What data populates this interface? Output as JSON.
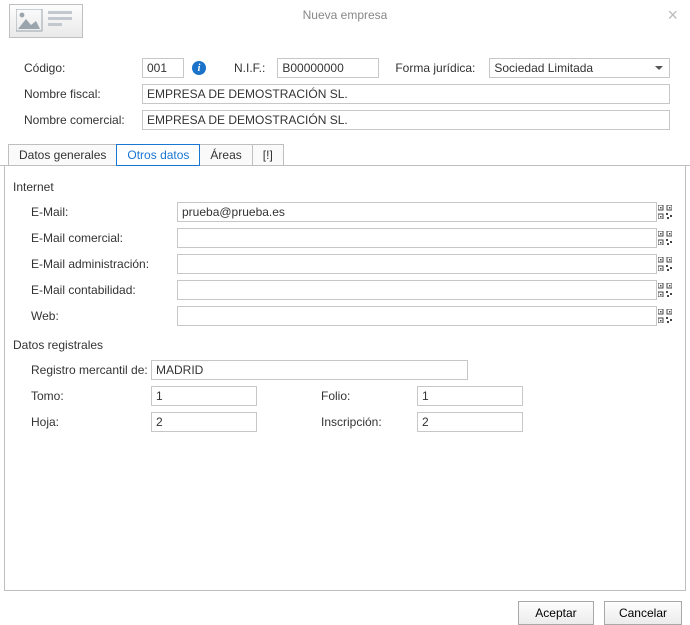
{
  "window": {
    "title": "Nueva empresa"
  },
  "header": {
    "codigo_label": "Código:",
    "codigo_value": "001",
    "nif_label": "N.I.F.:",
    "nif_value": "B00000000",
    "forma_label": "Forma jurídica:",
    "forma_value": "Sociedad Limitada",
    "nombre_fiscal_label": "Nombre fiscal:",
    "nombre_fiscal_value": "EMPRESA DE DEMOSTRACIÓN SL.",
    "nombre_comercial_label": "Nombre comercial:",
    "nombre_comercial_value": "EMPRESA DE DEMOSTRACIÓN SL."
  },
  "tabs": {
    "generales": "Datos generales",
    "otros": "Otros datos",
    "areas": "Áreas",
    "alert": "[!]"
  },
  "internet": {
    "section_title": "Internet",
    "email_label": "E-Mail:",
    "email_value": "prueba@prueba.es",
    "email_comercial_label": "E-Mail comercial:",
    "email_comercial_value": "",
    "email_admin_label": "E-Mail administración:",
    "email_admin_value": "",
    "email_cont_label": "E-Mail contabilidad:",
    "email_cont_value": "",
    "web_label": "Web:",
    "web_value": ""
  },
  "registrales": {
    "section_title": "Datos registrales",
    "registro_label": "Registro mercantil de:",
    "registro_value": "MADRID",
    "tomo_label": "Tomo:",
    "tomo_value": "1",
    "folio_label": "Folio:",
    "folio_value": "1",
    "hoja_label": "Hoja:",
    "hoja_value": "2",
    "inscripcion_label": "Inscripción:",
    "inscripcion_value": "2"
  },
  "footer": {
    "aceptar": "Aceptar",
    "cancelar": "Cancelar"
  }
}
